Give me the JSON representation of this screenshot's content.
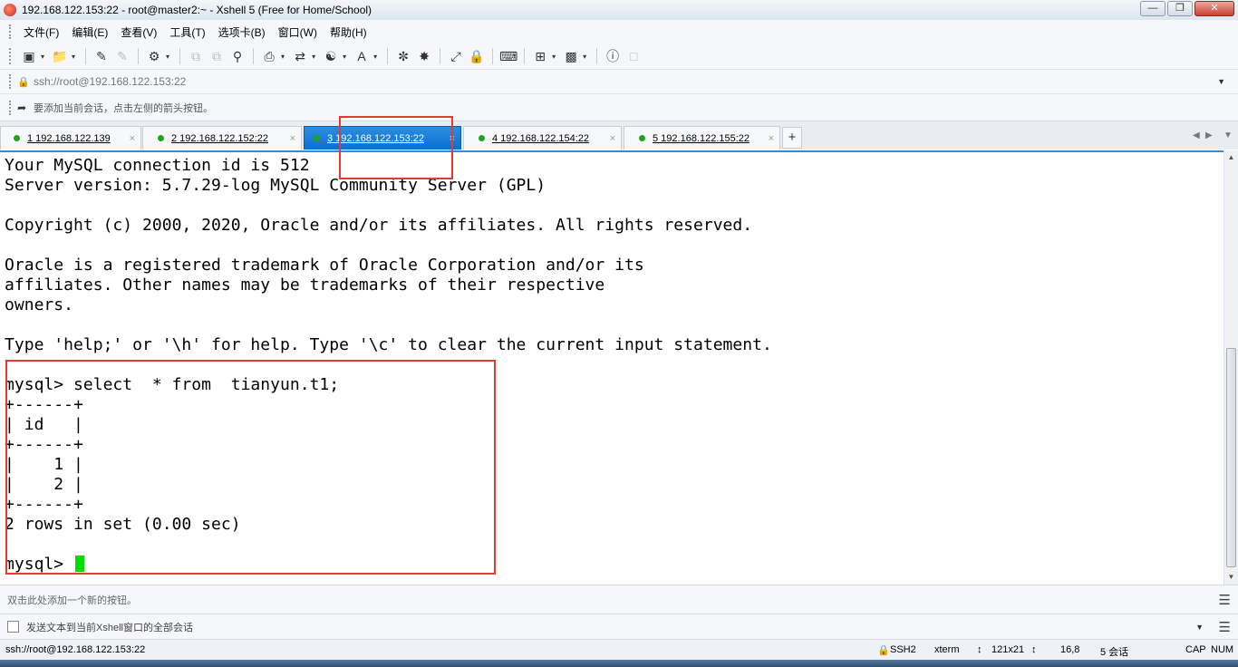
{
  "window": {
    "title": "192.168.122.153:22 - root@master2:~ - Xshell 5 (Free for Home/School)",
    "controls": [
      "0",
      "1",
      "r"
    ]
  },
  "menu": [
    "文件(F)",
    "编辑(E)",
    "查看(V)",
    "工具(T)",
    "选项卡(B)",
    "窗口(W)",
    "帮助(H)"
  ],
  "address": {
    "value": "ssh://root@192.168.122.153:22"
  },
  "hint": {
    "text": "要添加当前会话，点击左侧的箭头按钮。"
  },
  "tabs": [
    {
      "label": "1 192.168.122.139",
      "active": false
    },
    {
      "label": "2 192.168.122.152:22",
      "active": false
    },
    {
      "label": "3 192.168.122.153:22",
      "active": true
    },
    {
      "label": "4 192.168.122.154:22",
      "active": false
    },
    {
      "label": "5 192.168.122.155:22",
      "active": false
    }
  ],
  "terminal": {
    "lines": [
      "Your MySQL connection id is 512",
      "Server version: 5.7.29-log MySQL Community Server (GPL)",
      "",
      "Copyright (c) 2000, 2020, Oracle and/or its affiliates. All rights reserved.",
      "",
      "Oracle is a registered trademark of Oracle Corporation and/or its",
      "affiliates. Other names may be trademarks of their respective",
      "owners.",
      "",
      "Type 'help;' or '\\h' for help. Type '\\c' to clear the current input statement.",
      "",
      "mysql> select  * from  tianyun.t1;",
      "+------+",
      "| id   |",
      "+------+",
      "|    1 |",
      "|    2 |",
      "+------+",
      "2 rows in set (0.00 sec)",
      ""
    ],
    "prompt": "mysql> "
  },
  "quickbar": {
    "text": "双击此处添加一个新的按钮。"
  },
  "compose": {
    "text": "发送文本到当前Xshell窗口的全部会话"
  },
  "status": {
    "connection": "ssh://root@192.168.122.153:22",
    "protocol": "SSH2",
    "term": "xterm",
    "size": "121x21",
    "pos": "16,8",
    "sessions": "5 会话",
    "caps": "CAP",
    "num": "NUM"
  },
  "colors": {
    "accent": "#2a8fe0",
    "cursor": "#00e000",
    "highlight": "#e53935"
  }
}
